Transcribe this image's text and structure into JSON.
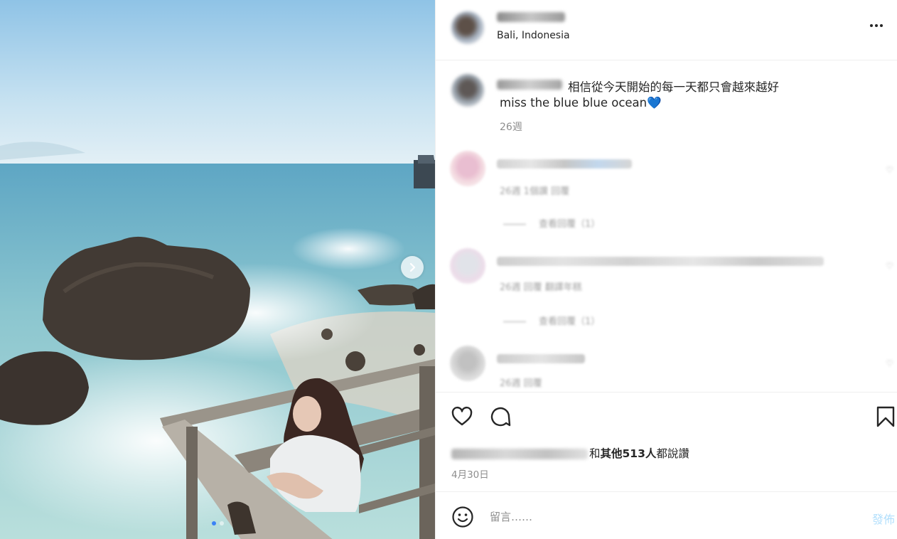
{
  "post": {
    "location": "Bali, Indonesia",
    "caption": {
      "line1": "相信從今天開始的每一天都只會越來越好",
      "line2": "miss the blue blue ocean💙",
      "time": "26週"
    },
    "comments": [
      {
        "meta": "26週   1個讚   回覆",
        "replies": "查看回覆（1）"
      },
      {
        "meta": "26週   回覆   翻譯年糕",
        "replies": "查看回覆（1）"
      },
      {
        "meta": "26週   回覆"
      }
    ],
    "likes": {
      "prefix": "和",
      "others": "其他513人",
      "suffix": "都說讚"
    },
    "date": "4月30日",
    "comment_box": {
      "placeholder": "留言……",
      "post_label": "發佈"
    }
  },
  "photo": {
    "carousel_dots": 2,
    "active_dot": 0
  },
  "colors": {
    "accent": "#3b82f6",
    "post_button_disabled": "#b2dffc",
    "meta_gray": "#8e8e8e",
    "text": "#262626"
  },
  "icons": [
    "chevron-right-icon",
    "more-icon",
    "heart-icon",
    "comment-icon",
    "bookmark-icon",
    "emoji-icon"
  ]
}
